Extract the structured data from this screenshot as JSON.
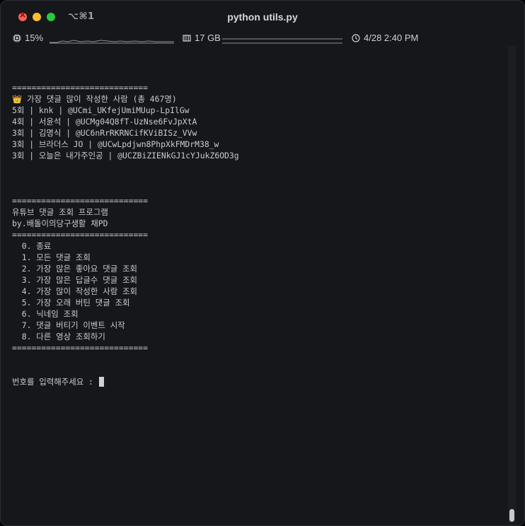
{
  "window": {
    "title": "python utils.py",
    "shortcut": "⌥⌘1"
  },
  "status": {
    "cpu": "15%",
    "memory": "17 GB",
    "datetime": "4/28 2:40 PM"
  },
  "terminal": {
    "lines": [
      "============================",
      "👑 가장 댓글 많이 작성한 사람 (총 467명)",
      "5회 | knk | @UCmi_UKfejUmiMUup-LpIlGw",
      "4회 | 서윤석 | @UCMg04Q8fT-UzNse6FvJpXtA",
      "3회 | 김명식 | @UC6nRrRKRNCifKViBISz_VVw",
      "3회 | 브라더스 JO | @UCwLpdjwn8PhpXkFMDrM38_w",
      "3회 | 오늘은 내가주인공 | @UCZBiZIENkGJ1cYJukZ6OD3g",
      "",
      "",
      "",
      "============================",
      "유튜브 댓글 조회 프로그램",
      "by.배돌이의당구생활 채PD",
      "============================",
      "  0. 종료",
      "  1. 모든 댓글 조회",
      "  2. 가장 많은 좋아요 댓글 조회",
      "  3. 가장 많은 답글수 댓글 조회",
      "  4. 가장 많이 작성한 사람 조회",
      "  5. 가장 오래 버틴 댓글 조회",
      "  6. 닉네임 조회",
      "  7. 댓글 버티기 이벤트 시작",
      "  8. 다른 영상 조회하기",
      "============================"
    ],
    "prompt": "번호를 입력해주세요 : "
  }
}
